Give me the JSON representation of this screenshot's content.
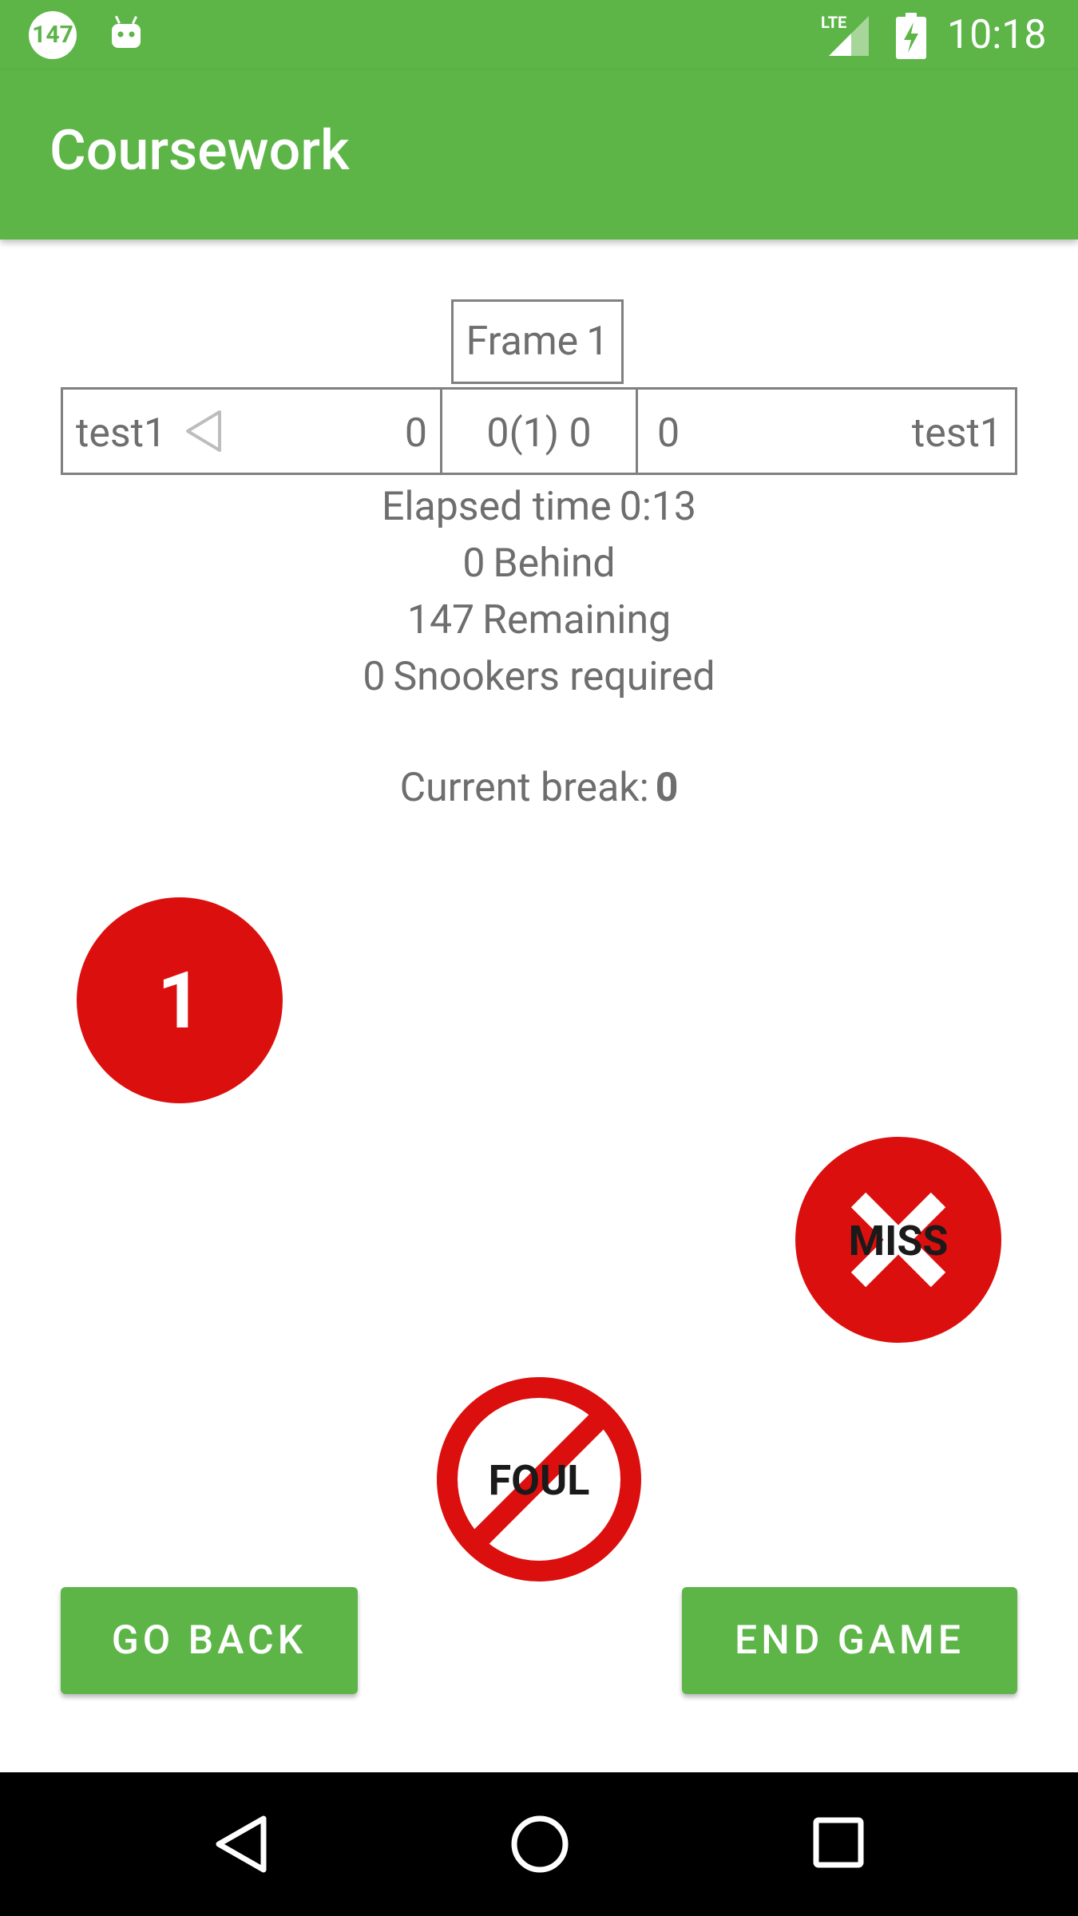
{
  "status_bar": {
    "app_icon_text": "147",
    "network_type": "LTE",
    "time": "10:18",
    "icons": [
      "app-147-icon",
      "android-icon",
      "lte-signal-icon",
      "battery-charging-icon"
    ]
  },
  "app_bar": {
    "title": "Coursework"
  },
  "frame": {
    "label": "Frame",
    "number": "1"
  },
  "scoreboard": {
    "player1": {
      "name": "test1",
      "score": "0",
      "turn_indicator": "triangle-left-icon"
    },
    "middle": "0(1) 0",
    "player2": {
      "name": "test1",
      "score": "0"
    }
  },
  "stats": {
    "elapsed_value": "0:13",
    "elapsed_label": "Elapsed time",
    "behind_value": "0",
    "behind_label": "Behind",
    "remaining_value": "147",
    "remaining_label": "Remaining",
    "snookers_value": "0",
    "snookers_label": "Snookers required"
  },
  "current_break": {
    "label": "Current break:",
    "value": "0"
  },
  "balls": {
    "red_value": "1",
    "miss_label": "MISS",
    "foul_label": "FOUL"
  },
  "buttons": {
    "go_back": "GO BACK",
    "end_game": "END GAME"
  },
  "colors": {
    "primary": "#5db548",
    "ball_red": "#dc0f0f",
    "text": "#6e6e6e",
    "nav_bar": "#000000"
  },
  "nav_bar": {
    "icons": [
      "back-icon",
      "home-icon",
      "recents-icon"
    ]
  }
}
